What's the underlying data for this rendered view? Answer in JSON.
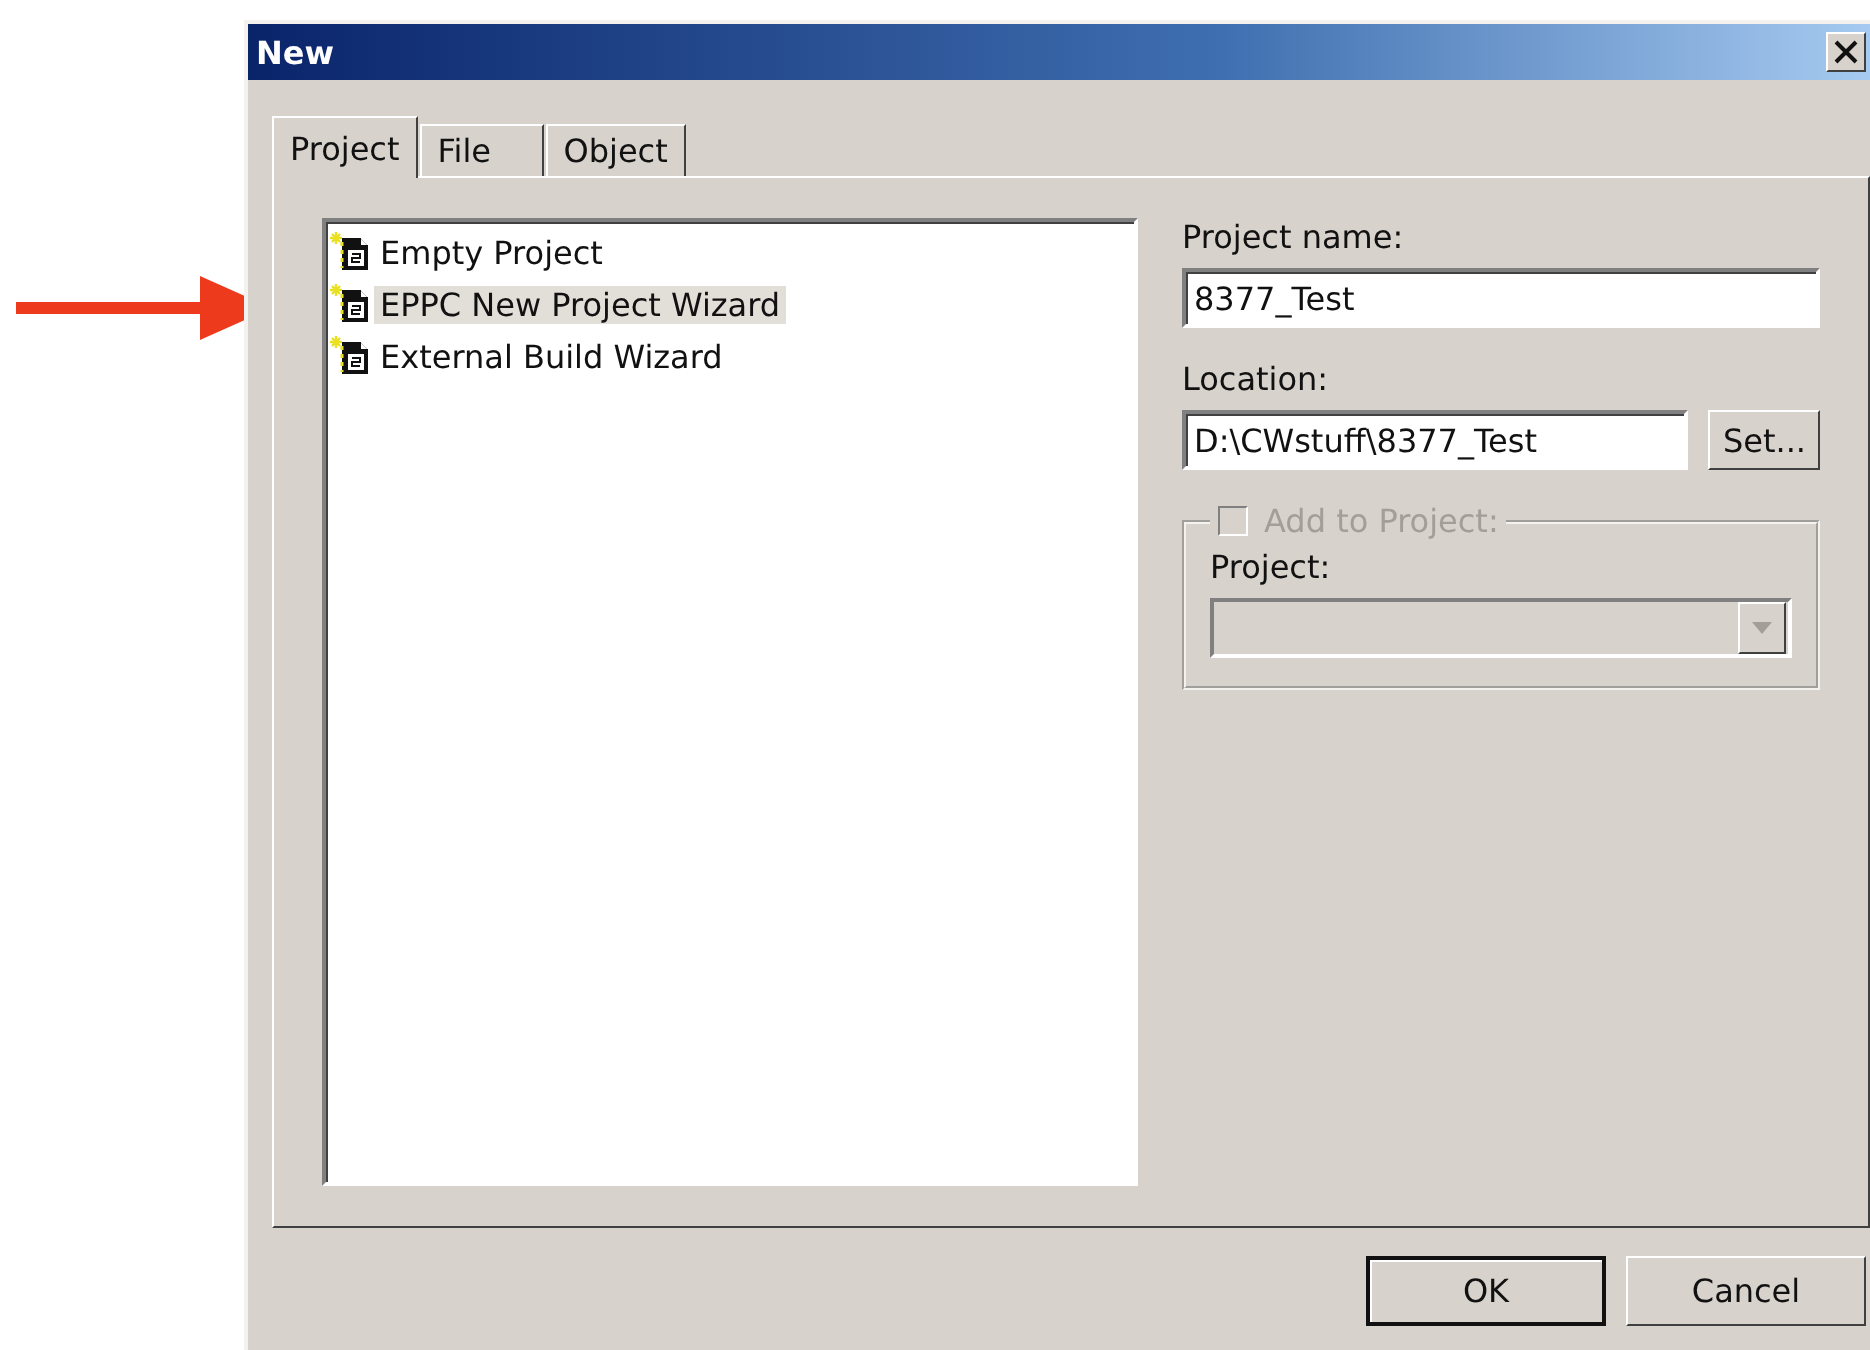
{
  "window": {
    "title": "New"
  },
  "tabs": [
    {
      "label": "Project",
      "selected": true
    },
    {
      "label": "File",
      "selected": false
    },
    {
      "label": "Object",
      "selected": false
    }
  ],
  "project_types": [
    {
      "label": "Empty Project",
      "selected": false
    },
    {
      "label": "EPPC New Project Wizard",
      "selected": true
    },
    {
      "label": "External Build Wizard",
      "selected": false
    }
  ],
  "project_name": {
    "label": "Project name:",
    "value": "8377_Test"
  },
  "location": {
    "label": "Location:",
    "value": "D:\\CWstuff\\8377_Test",
    "button": "Set..."
  },
  "add_to_project": {
    "label": "Add to Project:",
    "checked": false,
    "disabled": true,
    "project_label": "Project:"
  },
  "buttons": [
    {
      "label": "OK",
      "default": true
    },
    {
      "label": "Cancel",
      "default": false
    }
  ]
}
